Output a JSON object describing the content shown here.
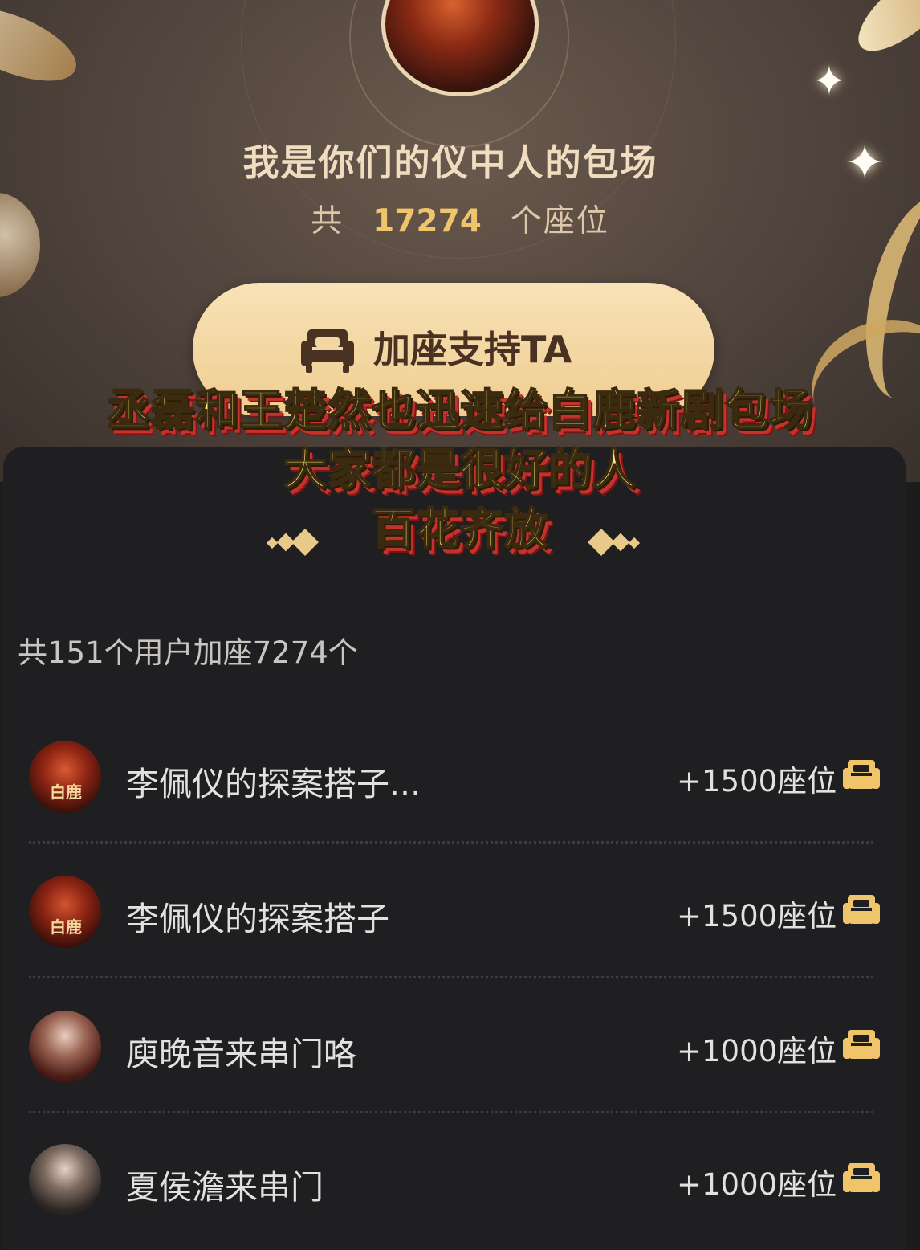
{
  "header": {
    "title": "我是你们的仪中人的包场",
    "count_prefix": "共",
    "count_value": "17274",
    "count_suffix": "个座位",
    "support_button_label": "加座支持TA"
  },
  "overlay_caption": {
    "lines": [
      "丞磊和王楚然也迅速给白鹿新剧包场",
      "大家都是很好的人",
      "百花齐放"
    ]
  },
  "summary": "共151个用户加座7274个",
  "supporters": [
    {
      "name": "李佩仪的探案搭子...",
      "seats": "+1500座位",
      "avatar_text": "白鹿"
    },
    {
      "name": "李佩仪的探案搭子",
      "seats": "+1500座位",
      "avatar_text": "白鹿"
    },
    {
      "name": "庾晚音来串门咯",
      "seats": "+1000座位",
      "avatar_text": ""
    },
    {
      "name": "夏侯澹来串门",
      "seats": "+1000座位",
      "avatar_text": ""
    }
  ],
  "colors": {
    "accent_gold": "#f0c46b",
    "button_bg": "#f3d7a3",
    "panel_bg": "#1f1f21",
    "caption_yellow": "#fff27a",
    "caption_red": "#c5322c"
  },
  "icons": [
    "sofa-icon",
    "sparkle-icon",
    "diamond-ornament-icon"
  ]
}
